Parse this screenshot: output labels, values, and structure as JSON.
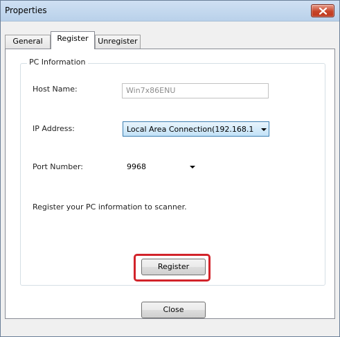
{
  "window": {
    "title": "Properties"
  },
  "tabs": [
    {
      "label": "General",
      "selected": false
    },
    {
      "label": "Register",
      "selected": true
    },
    {
      "label": "Unregister",
      "selected": false
    }
  ],
  "group": {
    "legend": "PC Information",
    "host_label": "Host Name:",
    "host_value": "Win7x86ENU",
    "ip_label": "IP Address:",
    "ip_value": "Local Area Connection(192.168.1",
    "port_label": "Port Number:",
    "port_value": "9968",
    "message": "Register your PC information to scanner."
  },
  "buttons": {
    "register": "Register",
    "close": "Close"
  },
  "colors": {
    "highlight": "#d2232a",
    "titlebar": "#c4d9ef",
    "close_button": "#c7452a"
  },
  "icons": {
    "title_close": "close-icon",
    "dropdown": "chevron-down-icon"
  }
}
